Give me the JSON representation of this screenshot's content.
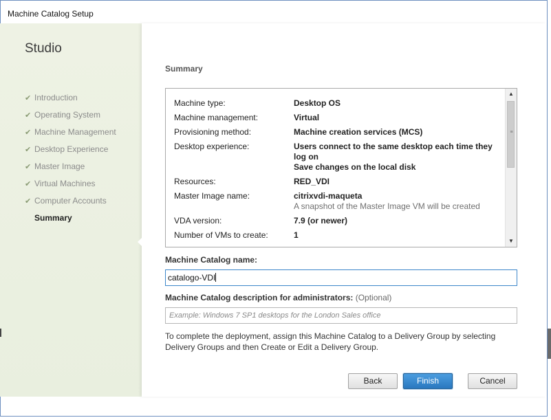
{
  "window": {
    "title": "Machine Catalog Setup"
  },
  "sidebar": {
    "heading": "Studio",
    "steps": [
      {
        "label": "Introduction",
        "done": true
      },
      {
        "label": "Operating System",
        "done": true
      },
      {
        "label": "Machine Management",
        "done": true
      },
      {
        "label": "Desktop Experience",
        "done": true
      },
      {
        "label": "Master Image",
        "done": true
      },
      {
        "label": "Virtual Machines",
        "done": true
      },
      {
        "label": "Computer Accounts",
        "done": true
      },
      {
        "label": "Summary",
        "done": false,
        "active": true
      }
    ],
    "check_glyph": "✔"
  },
  "main": {
    "title": "Summary",
    "summary": [
      {
        "key": "Machine type:",
        "value": "Desktop OS"
      },
      {
        "key": "Machine management:",
        "value": "Virtual"
      },
      {
        "key": "Provisioning method:",
        "value": "Machine creation services (MCS)"
      },
      {
        "key": "Desktop experience:",
        "value": "Users connect to the same desktop each time they log on",
        "value2": "Save changes on the local disk"
      },
      {
        "key": "Resources:",
        "value": "RED_VDI"
      },
      {
        "key": "Master Image name:",
        "value": "citrixvdi-maqueta",
        "note": "A snapshot of the Master Image VM will be created"
      },
      {
        "key": "VDA version:",
        "value": "7.9 (or newer)"
      },
      {
        "key": "Number of VMs to create:",
        "value": "1"
      }
    ],
    "catalog_name_label": "Machine Catalog name:",
    "catalog_name_value": "catalogo-VDI",
    "description_label": "Machine Catalog description for administrators:",
    "description_optional": "(Optional)",
    "description_placeholder": "Example: Windows 7 SP1 desktops for the London Sales office",
    "info": "To complete the deployment, assign this Machine Catalog to a Delivery Group by selecting Delivery Groups and then Create or Edit a Delivery Group."
  },
  "buttons": {
    "back": "Back",
    "finish": "Finish",
    "cancel": "Cancel"
  },
  "icons": {
    "scroll_up": "▲",
    "scroll_down": "▼",
    "grip": "≡"
  },
  "colors": {
    "accent": "#2a78bf",
    "sidebar_bg": "#eef2e4",
    "focus_border": "#3b86c9"
  }
}
